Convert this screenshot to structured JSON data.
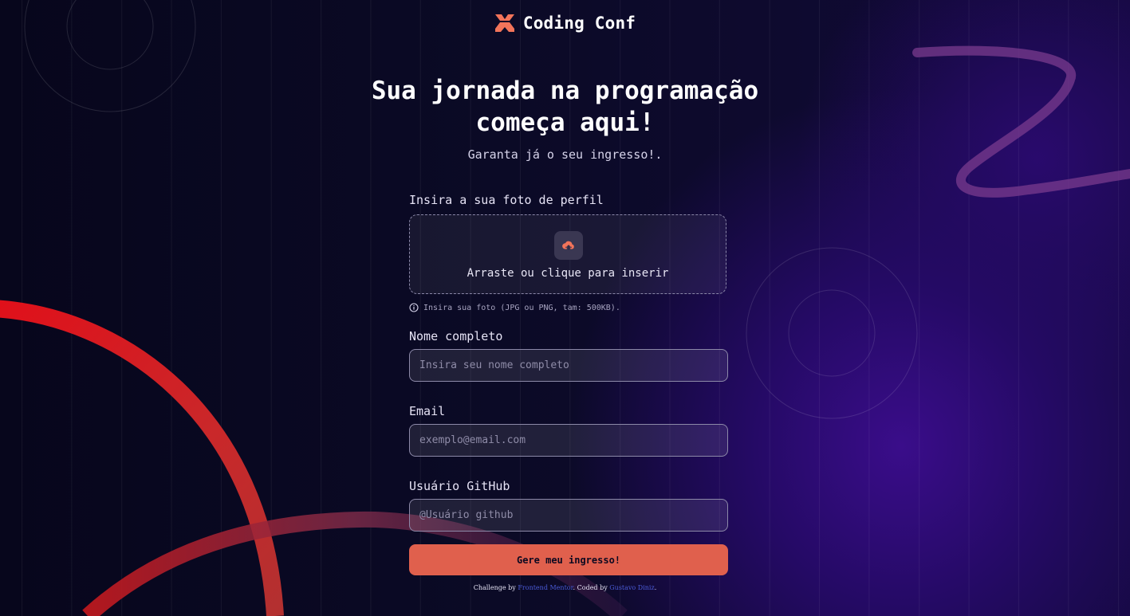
{
  "brand": {
    "name": "Coding Conf",
    "logo_icon": "coding-conf-logo-icon",
    "accent": "#f2745a"
  },
  "hero": {
    "title_line1": "Sua jornada na programação",
    "title_line2": "começa aqui!",
    "subtitle": "Garanta já o seu ingresso!."
  },
  "form": {
    "avatar": {
      "label": "Insira a sua foto de perfil",
      "upload_text": "Arraste ou clique para inserir",
      "upload_icon": "upload-cloud-icon",
      "hint_icon": "info-icon",
      "hint": "Insira sua foto (JPG ou PNG, tam: 500KB)."
    },
    "name": {
      "label": "Nome completo",
      "placeholder": "Insira seu nome completo",
      "value": ""
    },
    "email": {
      "label": "Email",
      "placeholder": "exemplo@email.com",
      "value": ""
    },
    "github": {
      "label": "Usuário GitHub",
      "placeholder": "@Usuário github",
      "value": ""
    },
    "submit_label": "Gere meu ingresso!",
    "submit_color": "#e0604d"
  },
  "footer": {
    "challenge_prefix": "Challenge by ",
    "challenge_link": "Frontend Mentor",
    "coded_prefix": ". Coded by ",
    "coded_link": "Gustavo Diniz",
    "suffix": "."
  }
}
